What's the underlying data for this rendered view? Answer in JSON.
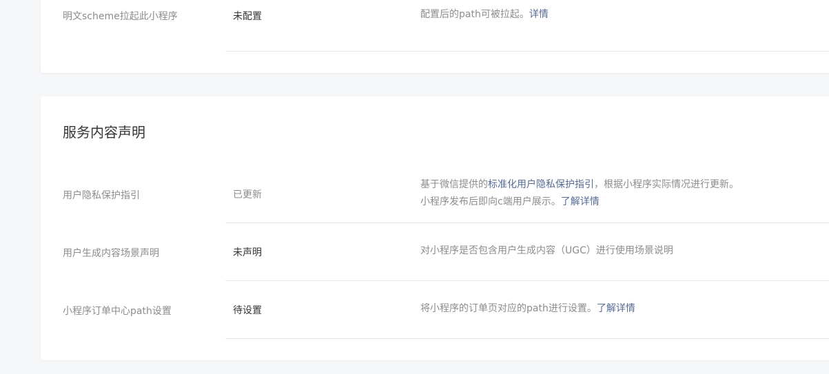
{
  "top_section": {
    "row": {
      "label": "明文scheme拉起此小程序",
      "value": "未配置",
      "desc_text": "配置后的path可被拉起。",
      "desc_link": "详情"
    }
  },
  "service_section": {
    "title": "服务内容声明",
    "rows": [
      {
        "label": "用户隐私保护指引",
        "value": "已更新",
        "desc_prefix": "基于微信提供的",
        "desc_link1": "标准化用户隐私保护指引",
        "desc_suffix": "，根据小程序实际情况进行更新。",
        "desc_line2": "小程序发布后即向c端用户展示。",
        "desc_link2": "了解详情"
      },
      {
        "label": "用户生成内容场景声明",
        "value": "未声明",
        "desc_text": "对小程序是否包含用户生成内容（UGC）进行使用场景说明"
      },
      {
        "label": "小程序订单中心path设置",
        "value": "待设置",
        "desc_text": "将小程序的订单页对应的path进行设置。",
        "desc_link": "了解详情"
      }
    ]
  },
  "colors": {
    "link": "#576b95",
    "label": "#8c8c8c",
    "text": "#353535",
    "divider": "#e7e7eb",
    "background": "#f6f7f9"
  }
}
